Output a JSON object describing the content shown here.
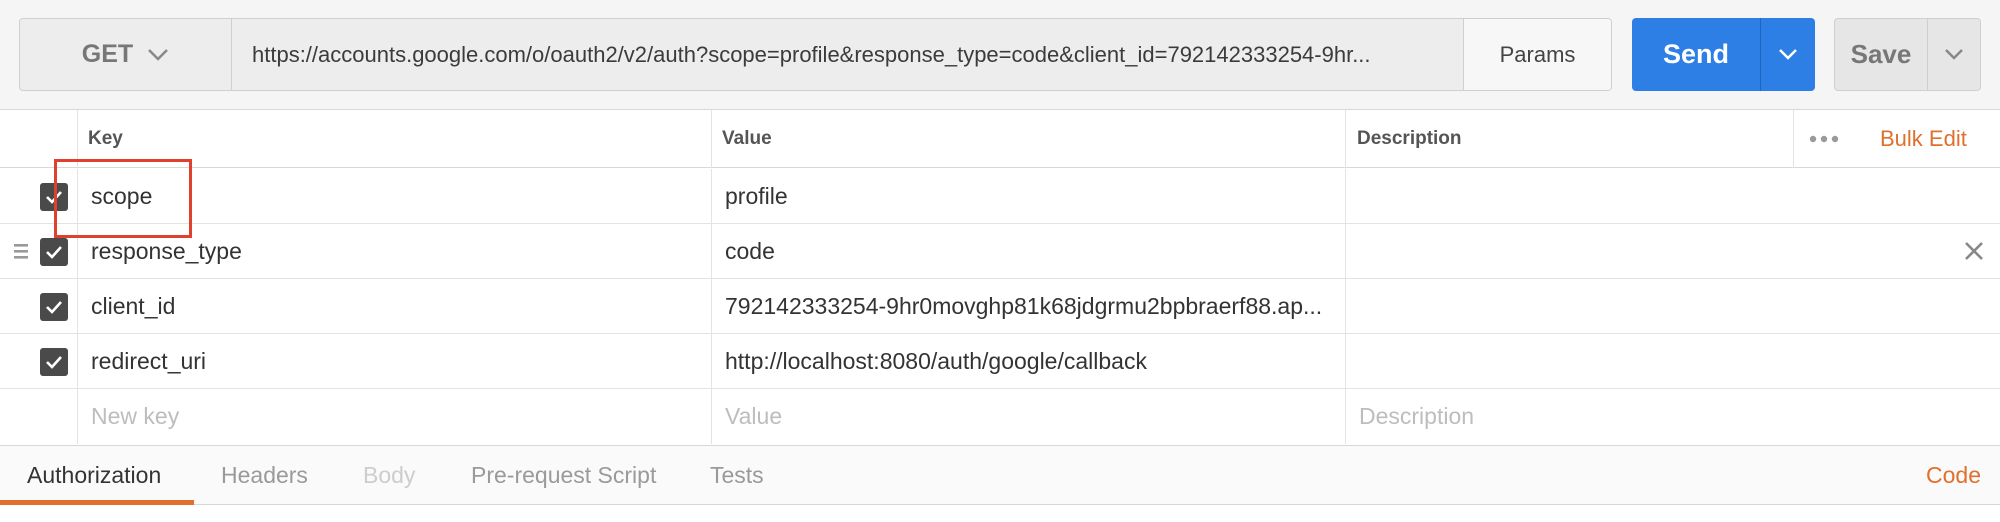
{
  "request": {
    "method": "GET",
    "url": "https://accounts.google.com/o/oauth2/v2/auth?scope=profile&response_type=code&client_id=792142333254-9hr...",
    "params_label": "Params",
    "send_label": "Send",
    "save_label": "Save"
  },
  "table": {
    "headers": {
      "key": "Key",
      "value": "Value",
      "description": "Description"
    },
    "bulk_edit_label": "Bulk Edit",
    "rows": [
      {
        "key": "scope",
        "value": "profile",
        "description": "",
        "checked": true
      },
      {
        "key": "response_type",
        "value": "code",
        "description": "",
        "checked": true
      },
      {
        "key": "client_id",
        "value": "792142333254-9hr0movghp81k68jdgrmu2bpbraerf88.ap...",
        "description": "",
        "checked": true
      },
      {
        "key": "redirect_uri",
        "value": "http://localhost:8080/auth/google/callback",
        "description": "",
        "checked": true
      }
    ],
    "new_row": {
      "key_placeholder": "New key",
      "value_placeholder": "Value",
      "description_placeholder": "Description"
    }
  },
  "tabs": {
    "items": [
      {
        "label": "Authorization",
        "state": "active"
      },
      {
        "label": "Headers",
        "state": "normal"
      },
      {
        "label": "Body",
        "state": "disabled"
      },
      {
        "label": "Pre-request Script",
        "state": "normal"
      },
      {
        "label": "Tests",
        "state": "normal"
      }
    ],
    "code_label": "Code"
  },
  "colors": {
    "send_button": "#2d7fe6",
    "accent_orange": "#e0702c",
    "highlight_box": "#e0402e"
  },
  "icons": {
    "method_dropdown": "chevron-down-icon",
    "send_dropdown": "chevron-down-icon",
    "save_dropdown": "chevron-down-icon",
    "checkbox": "checkmark-icon",
    "drag": "drag-handle-icon",
    "delete": "close-icon",
    "more": "more-dots-icon"
  }
}
